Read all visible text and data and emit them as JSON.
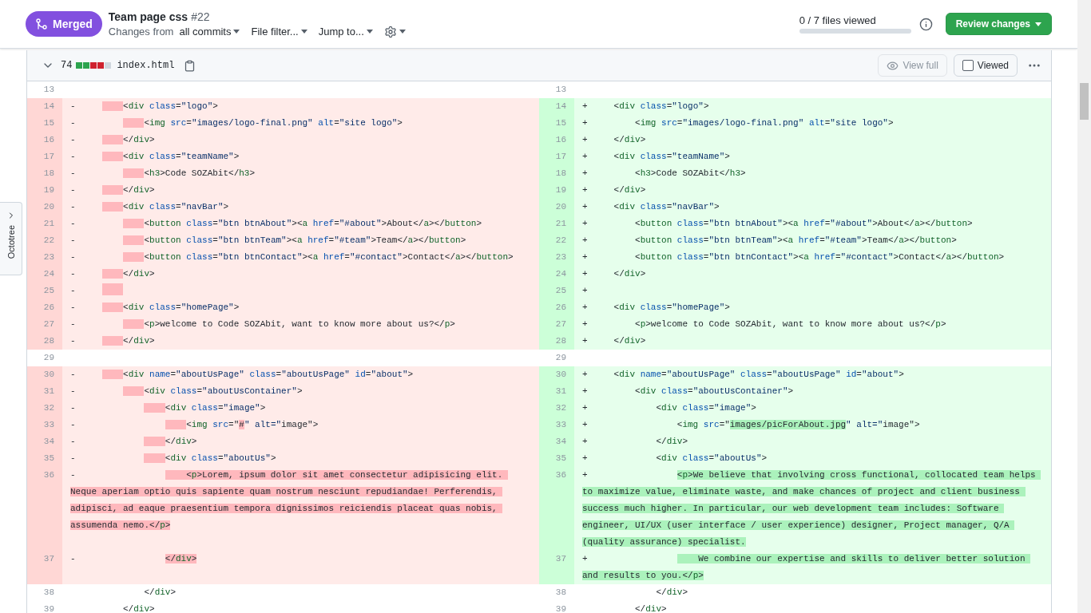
{
  "pr": {
    "status": "Merged",
    "title": "Team page css",
    "number": "#22",
    "changes_from": "Changes from",
    "commits": "all commits",
    "file_filter": "File filter...",
    "jump_to": "Jump to...",
    "files_viewed": "0 / 7 files viewed",
    "progress": {
      "level": 0
    },
    "review": "Review changes"
  },
  "octotree": {
    "label": "Octotree"
  },
  "file": {
    "expanded": true,
    "changes": "74",
    "diffstat": [
      {
        "color": "#2da44e"
      },
      {
        "color": "#2da44e"
      },
      {
        "color": "#cf222e"
      },
      {
        "color": "#cf222e"
      },
      {
        "color": "#d0d7de"
      }
    ],
    "name": "index.html",
    "view_full": {
      "label": "View full",
      "disabled": true
    },
    "viewed": {
      "label": "Viewed",
      "checked": false
    }
  },
  "rows": [
    {
      "left": {
        "kind": "context",
        "num": "13"
      },
      "right": {
        "kind": "context",
        "num": "13"
      }
    },
    {
      "left": {
        "kind": "deleted",
        "num": "14",
        "sign": "-",
        "indent_changed": true,
        "segments": [
          {
            "text": "         <div class=\"logo\">",
            "changed": false
          }
        ]
      },
      "right": {
        "kind": "added",
        "num": "14",
        "sign": "+",
        "indent_changed": false,
        "segments": [
          {
            "text": "     <div class=\"logo\">",
            "changed": false
          }
        ]
      }
    },
    {
      "left": {
        "kind": "deleted",
        "num": "15",
        "sign": "-",
        "indent_changed": true,
        "segments": [
          {
            "text": "             <img src=\"images/logo-final.png\" alt=\"site logo\">",
            "changed": false
          }
        ]
      },
      "right": {
        "kind": "added",
        "num": "15",
        "sign": "+",
        "indent_changed": false,
        "segments": [
          {
            "text": "         <img src=\"images/logo-final.png\" alt=\"site logo\">",
            "changed": false
          }
        ]
      }
    },
    {
      "left": {
        "kind": "deleted",
        "num": "16",
        "sign": "-",
        "indent_changed": true,
        "segments": [
          {
            "text": "         </div>",
            "changed": false
          }
        ]
      },
      "right": {
        "kind": "added",
        "num": "16",
        "sign": "+",
        "indent_changed": false,
        "segments": [
          {
            "text": "     </div>",
            "changed": false
          }
        ]
      }
    },
    {
      "left": {
        "kind": "deleted",
        "num": "17",
        "sign": "-",
        "indent_changed": true,
        "segments": [
          {
            "text": "         <div class=\"teamName\">",
            "changed": false
          }
        ]
      },
      "right": {
        "kind": "added",
        "num": "17",
        "sign": "+",
        "indent_changed": false,
        "segments": [
          {
            "text": "     <div class=\"teamName\">",
            "changed": false
          }
        ]
      }
    },
    {
      "left": {
        "kind": "deleted",
        "num": "18",
        "sign": "-",
        "indent_changed": true,
        "segments": [
          {
            "text": "             <h3>Code SOZAbit</h3>",
            "changed": false
          }
        ]
      },
      "right": {
        "kind": "added",
        "num": "18",
        "sign": "+",
        "indent_changed": false,
        "segments": [
          {
            "text": "         <h3>Code SOZAbit</h3>",
            "changed": false
          }
        ]
      }
    },
    {
      "left": {
        "kind": "deleted",
        "num": "19",
        "sign": "-",
        "indent_changed": true,
        "segments": [
          {
            "text": "         </div>",
            "changed": false
          }
        ]
      },
      "right": {
        "kind": "added",
        "num": "19",
        "sign": "+",
        "indent_changed": false,
        "segments": [
          {
            "text": "     </div>",
            "changed": false
          }
        ]
      }
    },
    {
      "left": {
        "kind": "deleted",
        "num": "20",
        "sign": "-",
        "indent_changed": true,
        "segments": [
          {
            "text": "         <div class=\"navBar\">",
            "changed": false
          }
        ]
      },
      "right": {
        "kind": "added",
        "num": "20",
        "sign": "+",
        "indent_changed": false,
        "segments": [
          {
            "text": "     <div class=\"navBar\">",
            "changed": false
          }
        ]
      }
    },
    {
      "left": {
        "kind": "deleted",
        "num": "21",
        "sign": "-",
        "indent_changed": true,
        "segments": [
          {
            "text": "             <button class=\"btn btnAbout\"><a href=\"#about\">About</a></button>",
            "changed": false
          }
        ]
      },
      "right": {
        "kind": "added",
        "num": "21",
        "sign": "+",
        "indent_changed": false,
        "segments": [
          {
            "text": "         <button class=\"btn btnAbout\"><a href=\"#about\">About</a></button>",
            "changed": false
          }
        ]
      }
    },
    {
      "left": {
        "kind": "deleted",
        "num": "22",
        "sign": "-",
        "indent_changed": true,
        "segments": [
          {
            "text": "             <button class=\"btn btnTeam\"><a href=\"#team\">Team</a></button>",
            "changed": false
          }
        ]
      },
      "right": {
        "kind": "added",
        "num": "22",
        "sign": "+",
        "indent_changed": false,
        "segments": [
          {
            "text": "         <button class=\"btn btnTeam\"><a href=\"#team\">Team</a></button>",
            "changed": false
          }
        ]
      }
    },
    {
      "left": {
        "kind": "deleted",
        "num": "23",
        "sign": "-",
        "indent_changed": true,
        "segments": [
          {
            "text": "             <button class=\"btn btnContact\"><a href=\"#contact\">Contact</a></button>",
            "changed": false
          }
        ]
      },
      "right": {
        "kind": "added",
        "num": "23",
        "sign": "+",
        "indent_changed": false,
        "segments": [
          {
            "text": "         <button class=\"btn btnContact\"><a href=\"#contact\">Contact</a></button>",
            "changed": false
          }
        ]
      }
    },
    {
      "left": {
        "kind": "deleted",
        "num": "24",
        "sign": "-",
        "indent_changed": true,
        "segments": [
          {
            "text": "         </div>",
            "changed": false
          }
        ]
      },
      "right": {
        "kind": "added",
        "num": "24",
        "sign": "+",
        "indent_changed": false,
        "segments": [
          {
            "text": "     </div>",
            "changed": false
          }
        ]
      }
    },
    {
      "left": {
        "kind": "deleted",
        "num": "25",
        "sign": "-",
        "indent_changed": true
      },
      "right": {
        "kind": "added",
        "num": "25",
        "sign": "+",
        "indent_changed": false
      }
    },
    {
      "left": {
        "kind": "deleted",
        "num": "26",
        "sign": "-",
        "indent_changed": true,
        "segments": [
          {
            "text": "         <div class=\"homePage\">",
            "changed": false
          }
        ]
      },
      "right": {
        "kind": "added",
        "num": "26",
        "sign": "+",
        "indent_changed": false,
        "segments": [
          {
            "text": "     <div class=\"homePage\">",
            "changed": false
          }
        ]
      }
    },
    {
      "left": {
        "kind": "deleted",
        "num": "27",
        "sign": "-",
        "indent_changed": true,
        "segments": [
          {
            "text": "             <p>welcome to Code SOZAbit, want to know more about us?</p>",
            "changed": false
          }
        ]
      },
      "right": {
        "kind": "added",
        "num": "27",
        "sign": "+",
        "indent_changed": false,
        "segments": [
          {
            "text": "         <p>welcome to Code SOZAbit, want to know more about us?</p>",
            "changed": false
          }
        ]
      }
    },
    {
      "left": {
        "kind": "deleted",
        "num": "28",
        "sign": "-",
        "indent_changed": true,
        "segments": [
          {
            "text": "         </div>",
            "changed": false
          }
        ]
      },
      "right": {
        "kind": "added",
        "num": "28",
        "sign": "+",
        "indent_changed": false,
        "segments": [
          {
            "text": "     </div>",
            "changed": false
          }
        ]
      }
    },
    {
      "left": {
        "kind": "context",
        "num": "29"
      },
      "right": {
        "kind": "context",
        "num": "29"
      }
    },
    {
      "left": {
        "kind": "deleted",
        "num": "30",
        "sign": "-",
        "indent_changed": true,
        "segments": [
          {
            "text": "         <div name=\"aboutUsPage\" class=\"aboutUsPage\" id=\"about\">",
            "changed": false
          }
        ]
      },
      "right": {
        "kind": "added",
        "num": "30",
        "sign": "+",
        "indent_changed": false,
        "segments": [
          {
            "text": "     <div name=\"aboutUsPage\" class=\"aboutUsPage\" id=\"about\">",
            "changed": false
          }
        ]
      }
    },
    {
      "left": {
        "kind": "deleted",
        "num": "31",
        "sign": "-",
        "indent_changed": true,
        "segments": [
          {
            "text": "             <div class=\"aboutUsContainer\">",
            "changed": false
          }
        ]
      },
      "right": {
        "kind": "added",
        "num": "31",
        "sign": "+",
        "indent_changed": false,
        "segments": [
          {
            "text": "         <div class=\"aboutUsContainer\">",
            "changed": false
          }
        ]
      }
    },
    {
      "left": {
        "kind": "deleted",
        "num": "32",
        "sign": "-",
        "indent_changed": true,
        "segments": [
          {
            "text": "                 <div class=\"image\">",
            "changed": false
          }
        ]
      },
      "right": {
        "kind": "added",
        "num": "32",
        "sign": "+",
        "indent_changed": false,
        "segments": [
          {
            "text": "             <div class=\"image\">",
            "changed": false
          }
        ]
      }
    },
    {
      "left": {
        "kind": "deleted",
        "num": "33",
        "sign": "-",
        "indent_changed": true,
        "segments": [
          {
            "text": "                     <img src=\"",
            "changed": false
          },
          {
            "text": "#",
            "changed": true
          },
          {
            "text": "\" alt=\"image\">",
            "changed": false
          }
        ]
      },
      "right": {
        "kind": "added",
        "num": "33",
        "sign": "+",
        "indent_changed": false,
        "segments": [
          {
            "text": "                 <img src=\"",
            "changed": false
          },
          {
            "text": "images/picForAbout.jpg",
            "changed": true
          },
          {
            "text": "\" alt=\"image\">",
            "changed": false
          }
        ]
      }
    },
    {
      "left": {
        "kind": "deleted",
        "num": "34",
        "sign": "-",
        "indent_changed": true,
        "segments": [
          {
            "text": "                 </div>",
            "changed": false
          }
        ]
      },
      "right": {
        "kind": "added",
        "num": "34",
        "sign": "+",
        "indent_changed": false,
        "segments": [
          {
            "text": "             </div>",
            "changed": false
          }
        ]
      }
    },
    {
      "left": {
        "kind": "deleted",
        "num": "35",
        "sign": "-",
        "indent_changed": true,
        "segments": [
          {
            "text": "                 <div class=\"aboutUs\">",
            "changed": false
          }
        ]
      },
      "right": {
        "kind": "added",
        "num": "35",
        "sign": "+",
        "indent_changed": false,
        "segments": [
          {
            "text": "             <div class=\"aboutUs\">",
            "changed": false
          }
        ]
      }
    },
    {
      "left": {
        "kind": "deleted",
        "num": "36",
        "sign": "-",
        "indent_changed": true,
        "segments": [
          {
            "text": "                     <p>Lorem, ipsum dolor sit amet consectetur adipisicing elit. Neque aperiam optio quis sapiente quam nostrum nesciunt repudiandae! Perferendis, adipisci, ad eaque praesentium tempora dignissimos reiciendis placeat quas nobis, assumenda nemo.</p>",
            "changed": true
          }
        ]
      },
      "right": {
        "kind": "added",
        "num": "36",
        "sign": "+",
        "indent_changed": false,
        "segments": [
          {
            "text": "                 <p>We believe that involving cross functional, collocated team helps to maximize value, eliminate waste, and make chances of project and client business success much higher. In particular, our web development team includes: Software engineer, UI/UX (user interface / user experience) designer, Project manager, Q/A (quality assurance) specialist.",
            "changed": true
          }
        ]
      }
    },
    {
      "left": {
        "kind": "deleted",
        "num": "37",
        "sign": "-",
        "indent_changed": false,
        "segments": [
          {
            "text": "                 </div>",
            "changed": true
          }
        ]
      },
      "right": {
        "kind": "added",
        "num": "37",
        "sign": "+",
        "indent_changed": true,
        "segments": [
          {
            "text": "                     We combine our expertise and skills to deliver better solution and results to you.</p>",
            "changed": true
          }
        ]
      }
    },
    {
      "left": {
        "kind": "context",
        "num": "38",
        "segments": [
          {
            "text": "             </div>",
            "changed": false
          }
        ]
      },
      "right": {
        "kind": "context",
        "num": "38",
        "segments": [
          {
            "text": "             </div>",
            "changed": false
          }
        ]
      }
    },
    {
      "left": {
        "kind": "context",
        "num": "39",
        "segments": [
          {
            "text": "         </div>",
            "changed": false
          }
        ]
      },
      "right": {
        "kind": "context",
        "num": "39",
        "segments": [
          {
            "text": "         </div>",
            "changed": false
          }
        ]
      }
    }
  ]
}
